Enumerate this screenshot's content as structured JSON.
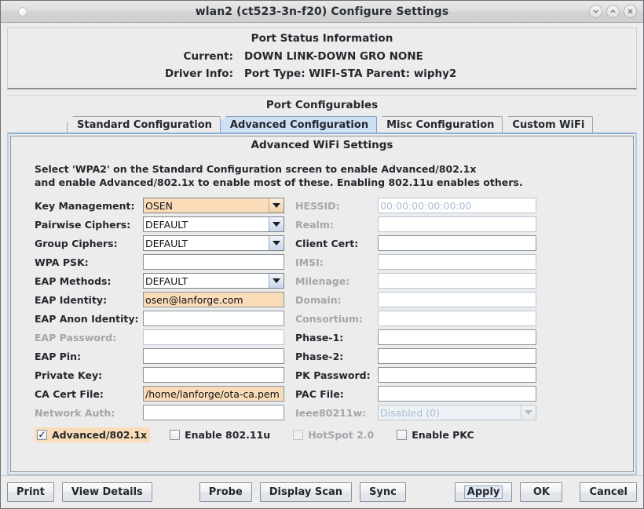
{
  "window": {
    "title": "wlan2  (ct523-3n-f20) Configure Settings",
    "titlebar_buttons": [
      {
        "name": "minimize",
        "glyph": "chevron-down"
      },
      {
        "name": "maximize",
        "glyph": "chevron-up"
      },
      {
        "name": "close",
        "glyph": "x"
      }
    ]
  },
  "status": {
    "heading": "Port Status Information",
    "current_label": "Current:",
    "current_value": "DOWN LINK-DOWN GRO  NONE",
    "driver_label": "Driver Info:",
    "driver_value": "Port Type: WIFI-STA   Parent: wiphy2"
  },
  "config": {
    "heading": "Port Configurables",
    "tabs": [
      {
        "label": "Standard Configuration",
        "selected": false
      },
      {
        "label": "Advanced Configuration",
        "selected": true
      },
      {
        "label": "Misc Configuration",
        "selected": false
      },
      {
        "label": "Custom WiFi",
        "selected": false
      }
    ],
    "panel_heading": "Advanced WiFi Settings",
    "intro_line1": "Select 'WPA2' on the Standard Configuration screen to enable Advanced/802.1x",
    "intro_line2": "and enable Advanced/802.1x to enable most of these. Enabling 802.11u enables others."
  },
  "form_rows": [
    {
      "left": {
        "label": "Key Management:",
        "type": "combo",
        "value": "OSEN",
        "highlight": true,
        "disabled": false,
        "label_dim": false
      },
      "right": {
        "label": "HESSID:",
        "type": "text",
        "value": "",
        "placeholder": "00:00:00:00:00:00",
        "highlight": false,
        "disabled": true,
        "label_dim": true
      }
    },
    {
      "left": {
        "label": "Pairwise Ciphers:",
        "type": "combo",
        "value": "DEFAULT",
        "highlight": false,
        "disabled": false,
        "label_dim": false
      },
      "right": {
        "label": "Realm:",
        "type": "text",
        "value": "",
        "placeholder": "",
        "highlight": false,
        "disabled": true,
        "label_dim": true
      }
    },
    {
      "left": {
        "label": "Group Ciphers:",
        "type": "combo",
        "value": "DEFAULT",
        "highlight": false,
        "disabled": false,
        "label_dim": false
      },
      "right": {
        "label": "Client Cert:",
        "type": "text",
        "value": "",
        "placeholder": "",
        "highlight": false,
        "disabled": false,
        "label_dim": false
      }
    },
    {
      "left": {
        "label": "WPA PSK:",
        "type": "text",
        "value": "",
        "highlight": false,
        "disabled": false,
        "label_dim": false
      },
      "right": {
        "label": "IMSI:",
        "type": "text",
        "value": "",
        "placeholder": "",
        "highlight": false,
        "disabled": true,
        "label_dim": true
      }
    },
    {
      "left": {
        "label": "EAP Methods:",
        "type": "combo",
        "value": "DEFAULT",
        "highlight": false,
        "disabled": false,
        "label_dim": false
      },
      "right": {
        "label": "Milenage:",
        "type": "text",
        "value": "",
        "placeholder": "",
        "highlight": false,
        "disabled": true,
        "label_dim": true
      }
    },
    {
      "left": {
        "label": "EAP Identity:",
        "type": "text",
        "value": "osen@lanforge.com",
        "highlight": true,
        "disabled": false,
        "label_dim": false
      },
      "right": {
        "label": "Domain:",
        "type": "text",
        "value": "",
        "placeholder": "",
        "highlight": false,
        "disabled": true,
        "label_dim": true
      }
    },
    {
      "left": {
        "label": "EAP Anon Identity:",
        "type": "text",
        "value": "",
        "highlight": false,
        "disabled": false,
        "label_dim": false
      },
      "right": {
        "label": "Consortium:",
        "type": "text",
        "value": "",
        "placeholder": "",
        "highlight": false,
        "disabled": true,
        "label_dim": true
      }
    },
    {
      "left": {
        "label": "EAP Password:",
        "type": "text",
        "value": "",
        "highlight": false,
        "disabled": true,
        "label_dim": true
      },
      "right": {
        "label": "Phase-1:",
        "type": "text",
        "value": "",
        "placeholder": "",
        "highlight": false,
        "disabled": false,
        "label_dim": false
      }
    },
    {
      "left": {
        "label": "EAP Pin:",
        "type": "text",
        "value": "",
        "highlight": false,
        "disabled": false,
        "label_dim": false
      },
      "right": {
        "label": "Phase-2:",
        "type": "text",
        "value": "",
        "placeholder": "",
        "highlight": false,
        "disabled": false,
        "label_dim": false
      }
    },
    {
      "left": {
        "label": "Private Key:",
        "type": "text",
        "value": "",
        "highlight": false,
        "disabled": false,
        "label_dim": false
      },
      "right": {
        "label": "PK Password:",
        "type": "text",
        "value": "",
        "placeholder": "",
        "highlight": false,
        "disabled": false,
        "label_dim": false
      }
    },
    {
      "left": {
        "label": "CA Cert File:",
        "type": "text",
        "value": "/home/lanforge/ota-ca.pem",
        "highlight": true,
        "disabled": false,
        "label_dim": false
      },
      "right": {
        "label": "PAC File:",
        "type": "text",
        "value": "",
        "placeholder": "",
        "highlight": false,
        "disabled": false,
        "label_dim": false
      }
    },
    {
      "left": {
        "label": "Network Auth:",
        "type": "text",
        "value": "",
        "highlight": false,
        "disabled": false,
        "label_dim": true
      },
      "right": {
        "label": "Ieee80211w:",
        "type": "combo",
        "value": "Disabled (0)",
        "highlight": false,
        "disabled": true,
        "label_dim": true
      }
    }
  ],
  "checkboxes": [
    {
      "label": "Advanced/802.1x",
      "checked": true,
      "disabled": false,
      "highlight": true
    },
    {
      "label": "Enable 802.11u",
      "checked": false,
      "disabled": false,
      "highlight": false
    },
    {
      "label": "HotSpot 2.0",
      "checked": false,
      "disabled": true,
      "highlight": false
    },
    {
      "label": "Enable PKC",
      "checked": false,
      "disabled": false,
      "highlight": false
    }
  ],
  "buttons": {
    "print": "Print",
    "view_details": "View Details",
    "probe": "Probe",
    "display_scan": "Display Scan",
    "sync": "Sync",
    "apply": "Apply",
    "ok": "OK",
    "cancel": "Cancel"
  },
  "colors": {
    "highlight": "#fadcb8",
    "tab_selected": "#cfe0f5",
    "panel_bg": "#ececec",
    "disabled_text": "#a3a6aa"
  }
}
